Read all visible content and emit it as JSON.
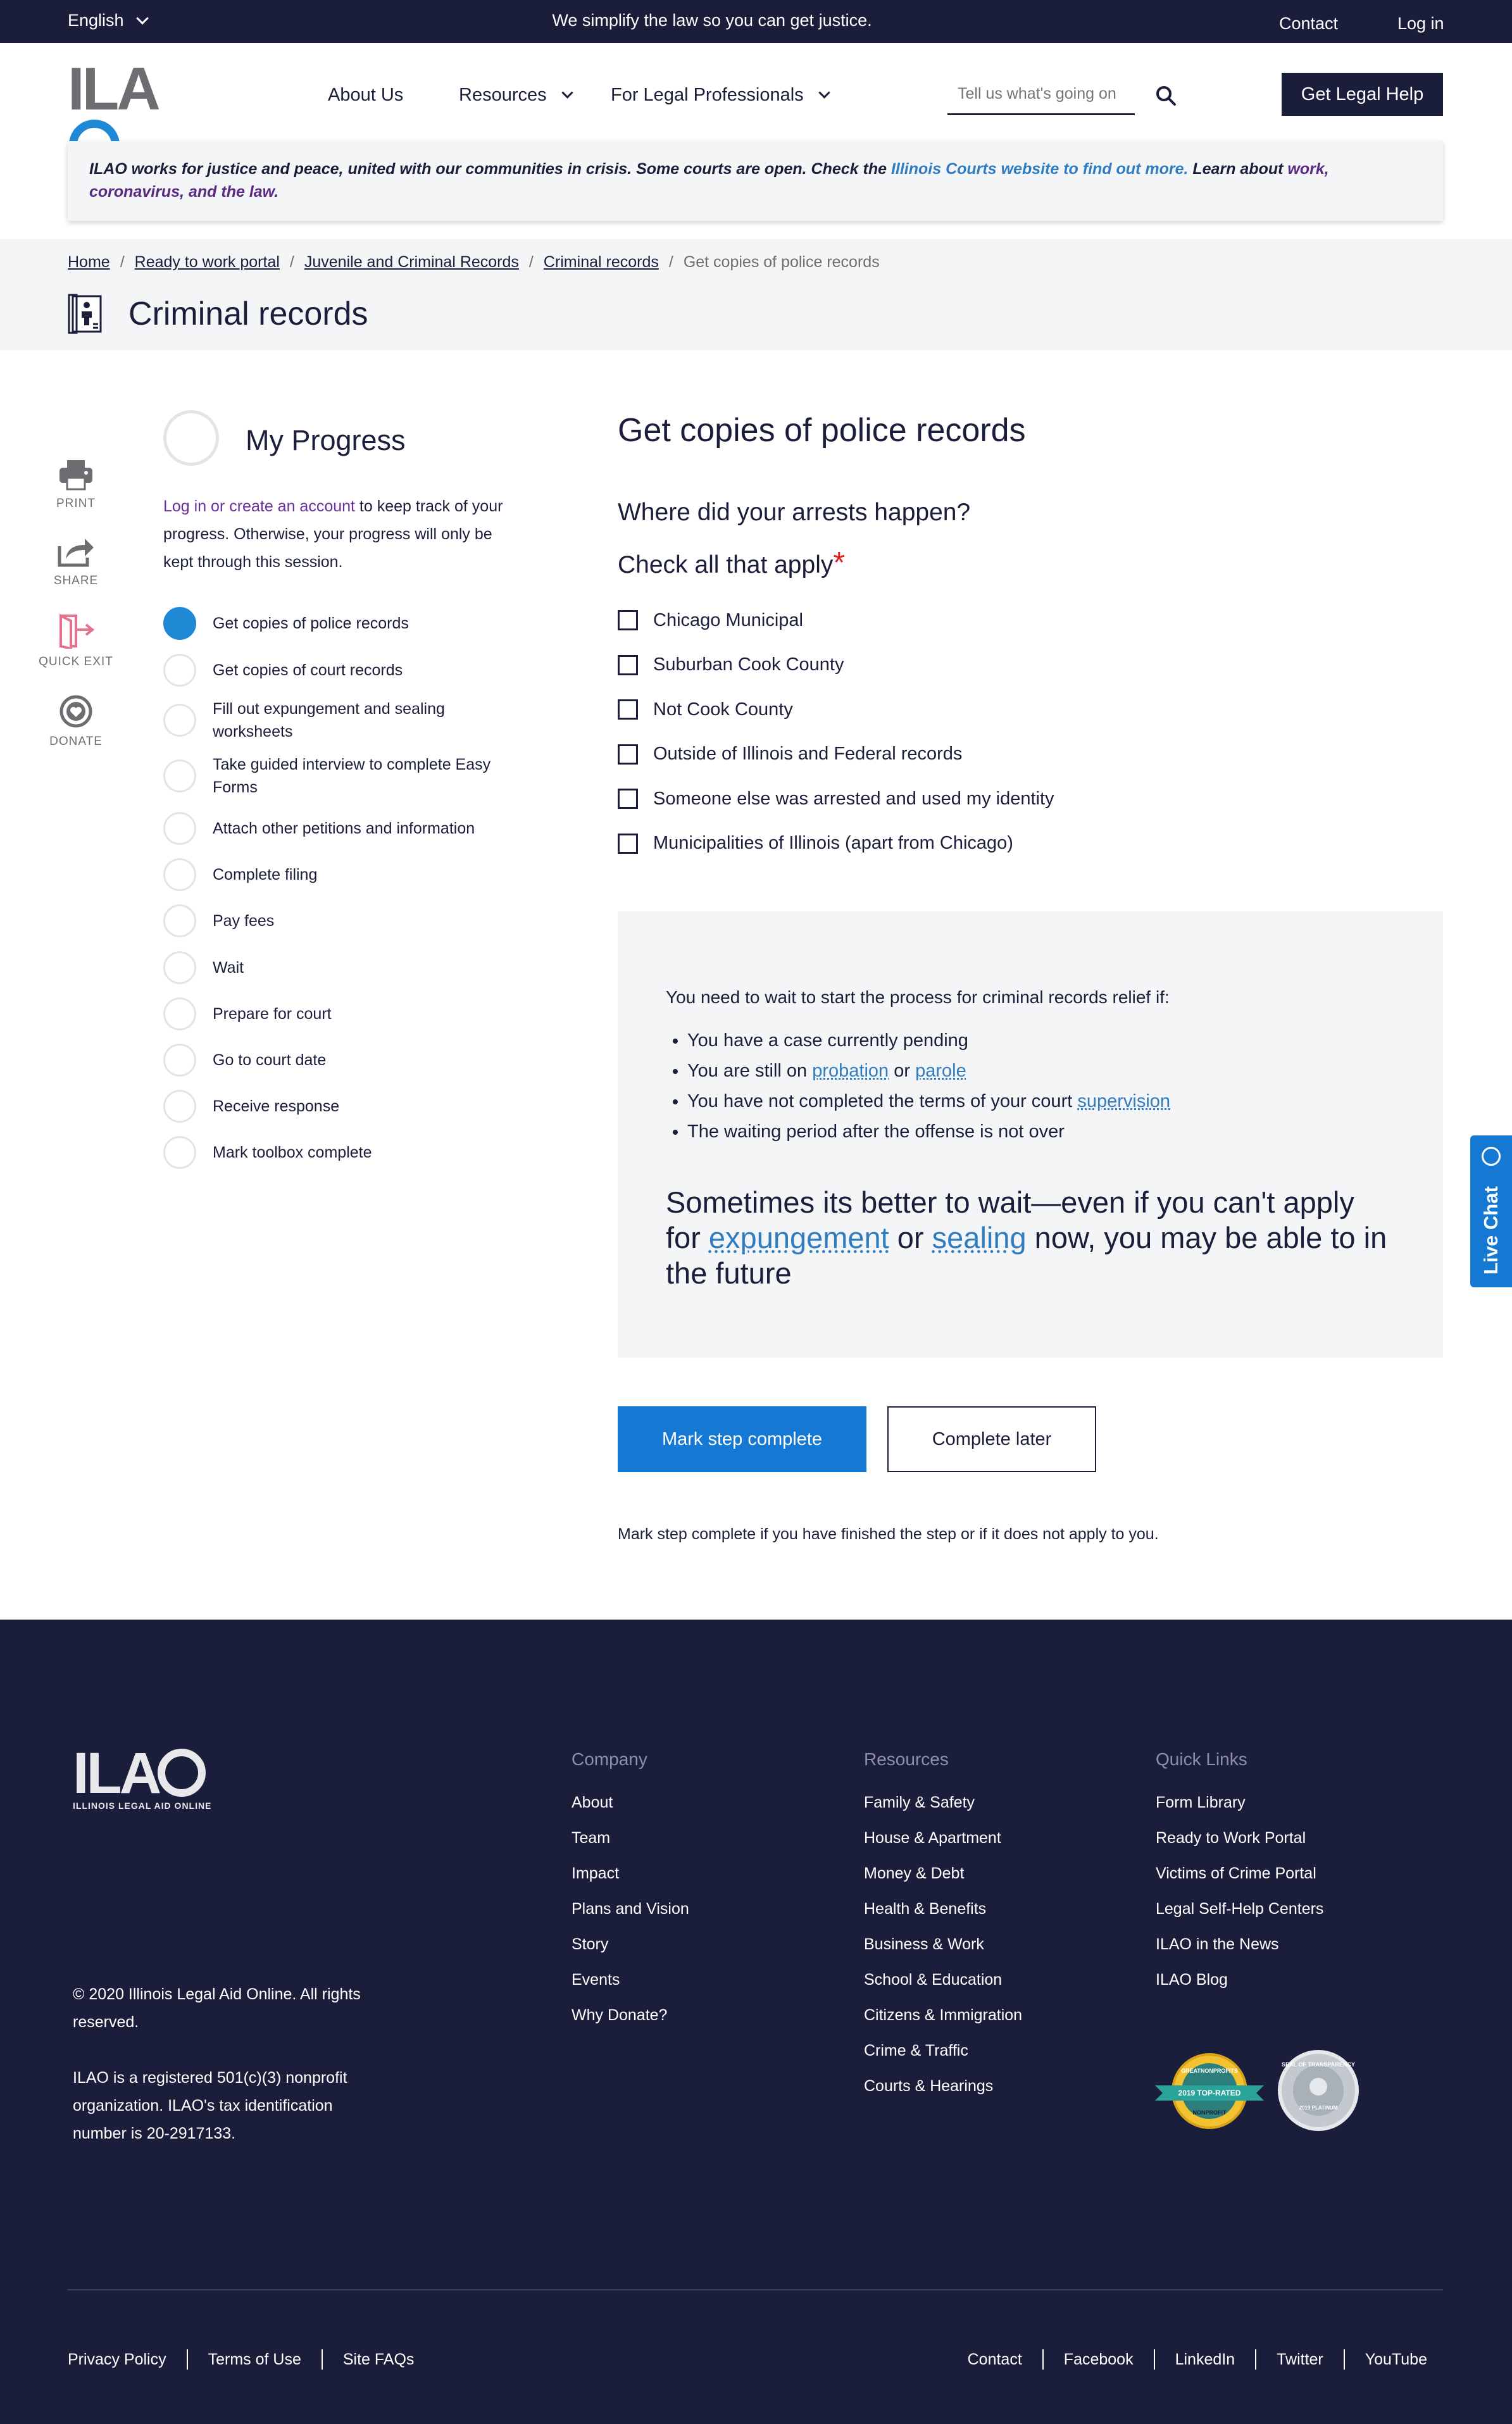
{
  "topbar": {
    "language": "English",
    "tagline": "We simplify the law so you can get justice.",
    "contact": "Contact",
    "login": "Log in"
  },
  "header": {
    "logo_text": "ILAO",
    "logo_subtitle": "ILLINOIS LEGAL AID ONLINE",
    "nav": [
      "About Us",
      "Resources",
      "For Legal Professionals"
    ],
    "search_placeholder": "Tell us what's going on",
    "cta": "Get Legal Help"
  },
  "alert": {
    "text1": "ILAO works for justice and peace, united with our communities in crisis. Some courts are open. Check the ",
    "link1": "Illinois Courts website to find out more.",
    "text2": " Learn about ",
    "link2": "work, coronavirus, and the law."
  },
  "breadcrumb": {
    "items": [
      "Home",
      "Ready to work portal",
      "Juvenile and Criminal Records",
      "Criminal records"
    ],
    "current": "Get copies of police records"
  },
  "page_title": "Criminal records",
  "tools": [
    "PRINT",
    "SHARE",
    "QUICK EXIT",
    "DONATE"
  ],
  "progress": {
    "title": "My Progress",
    "login_link": "Log in or create an account",
    "note": " to keep track of your progress. Otherwise, your progress will only be kept through this session.",
    "steps": [
      "Get copies of police records",
      "Get copies of court records",
      "Fill out expungement and sealing worksheets",
      "Take guided interview to complete Easy Forms",
      "Attach other petitions and information",
      "Complete filing",
      "Pay fees",
      "Wait",
      "Prepare for court",
      "Go to court date",
      "Receive response",
      "Mark toolbox complete"
    ]
  },
  "main": {
    "heading": "Get copies of police records",
    "question": "Where did your arrests happen?",
    "check_label": "Check all that apply",
    "required_mark": "*",
    "options": [
      "Chicago Municipal",
      "Suburban Cook County",
      "Not Cook County",
      "Outside of Illinois and Federal records",
      "Someone else was arrested and used my identity",
      "Municipalities of Illinois (apart from Chicago)"
    ]
  },
  "wait_box": {
    "intro": "You need to wait to start the process for criminal records relief if:",
    "b1": "You have a case currently pending",
    "b2_pre": "You are still on ",
    "b2_link1": "probation",
    "b2_mid": " or ",
    "b2_link2": "parole",
    "b3_pre": "You have not completed the terms of your court ",
    "b3_link": "supervision",
    "b4": "The waiting period after the offense is not over",
    "big_pre": "Sometimes its better to wait—even if you can't apply for ",
    "big_link1": "expungement",
    "big_mid": " or ",
    "big_link2": "sealing",
    "big_post": " now, you may be able to in the future"
  },
  "actions": {
    "complete": "Mark step complete",
    "later": "Complete later",
    "hint": "Mark step complete if you have finished the step or if it does not apply to you."
  },
  "live_chat": "Live Chat",
  "footer": {
    "copyright": "© 2020 Illinois Legal Aid Online. All rights reserved.",
    "nonprofit": "ILAO is a registered 501(c)(3) nonprofit organization. ILAO's tax identification number is 20-2917133.",
    "company": {
      "heading": "Company",
      "links": [
        "About",
        "Team",
        "Impact",
        "Plans and Vision",
        "Story",
        "Events",
        "Why Donate?"
      ]
    },
    "resources": {
      "heading": "Resources",
      "links": [
        "Family & Safety",
        "House & Apartment",
        "Money & Debt",
        "Health & Benefits",
        "Business & Work",
        "School & Education",
        "Citizens & Immigration",
        "Crime & Traffic",
        "Courts & Hearings"
      ]
    },
    "quick_links": {
      "heading": "Quick Links",
      "links": [
        "Form Library",
        "Ready to Work Portal",
        "Victims of Crime Portal",
        "Legal Self-Help Centers",
        "ILAO in the News",
        "ILAO Blog"
      ]
    },
    "badges": {
      "b1_top": "GREATNONPROFITS",
      "b1_mid": "2019 TOP-RATED",
      "b1_bottom": "NONPROFIT",
      "b2_top": "SEAL OF TRANSPARENCY",
      "b2_bottom": "2019 PLATINUM"
    },
    "bottom_left": [
      "Privacy Policy",
      "Terms of Use",
      "Site FAQs"
    ],
    "bottom_right": [
      "Contact",
      "Facebook",
      "LinkedIn",
      "Twitter",
      "YouTube"
    ]
  },
  "colors": {
    "navy": "#1b1e3a",
    "blue": "#1579d3",
    "link_blue": "#2f7dc0",
    "purple": "#6c2ea0",
    "required": "#e02020"
  }
}
